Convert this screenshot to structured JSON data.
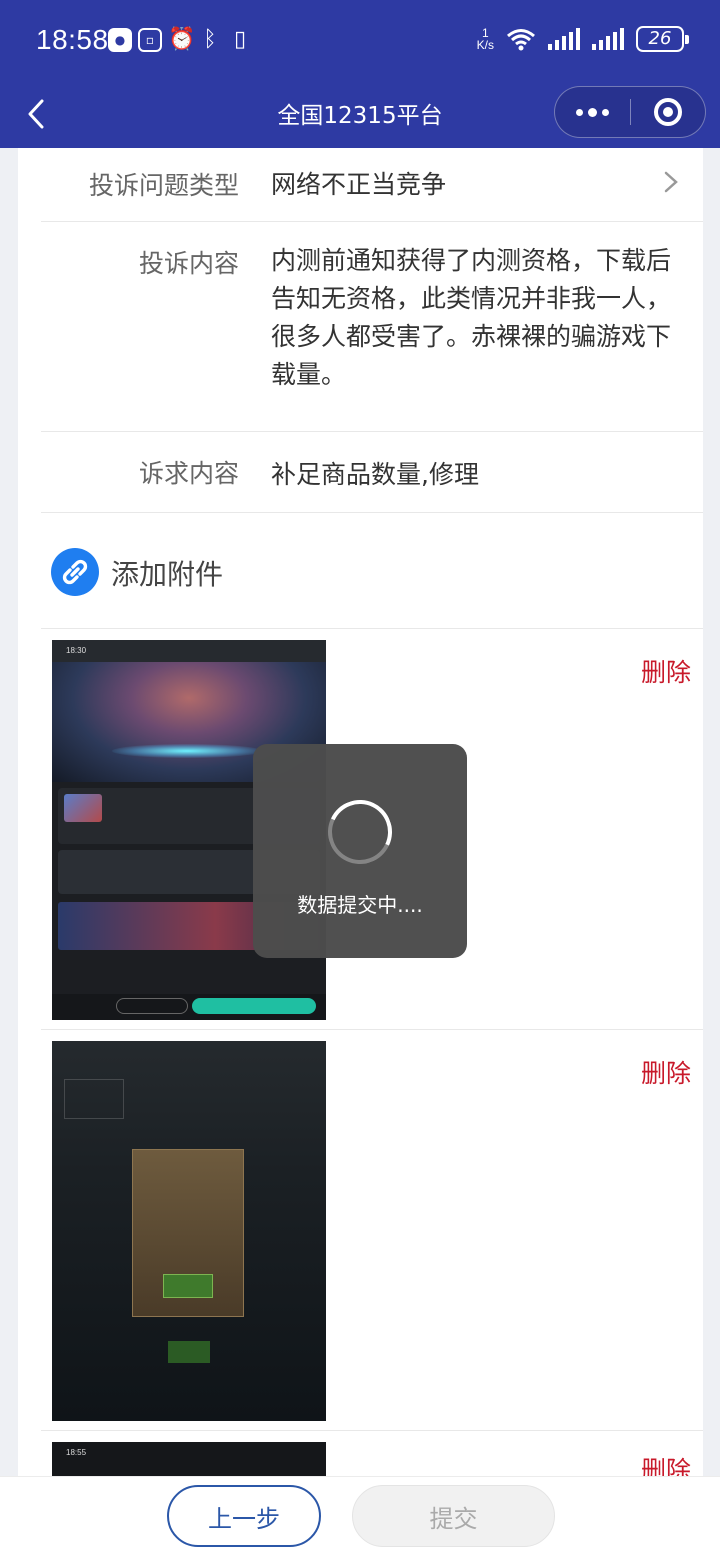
{
  "status_bar": {
    "time": "18:58",
    "net_speed_value": "1",
    "net_speed_unit": "K/s",
    "battery": "26",
    "left_icons": [
      "wechat-icon",
      "app-icon",
      "alarm-icon",
      "bluetooth-icon",
      "vibrate-icon"
    ]
  },
  "nav": {
    "title": "全国12315平台"
  },
  "form": {
    "complaint_type": {
      "label": "投诉问题类型",
      "value": "网络不正当竞争"
    },
    "complaint_content": {
      "label": "投诉内容",
      "value": "内测前通知获得了内测资格，下载后告知无资格，此类情况并非我一人，很多人都受害了。赤裸裸的骗游戏下载量。"
    },
    "request_content": {
      "label": "诉求内容",
      "value": "补足商品数量,修理"
    }
  },
  "attachments": {
    "add_label": "添加附件",
    "delete_label": "删除",
    "items": [
      {
        "thumb_time": "18:30"
      },
      {
        "thumb_time": ""
      },
      {
        "thumb_time": "18:55"
      }
    ]
  },
  "loading": {
    "text": "数据提交中...."
  },
  "footer": {
    "prev_label": "上一步",
    "submit_label": "提交"
  },
  "colors": {
    "header": "#2e3aa3",
    "delete": "#c8192a",
    "attach_icon": "#1f7ef0",
    "prev_border": "#2b57a8"
  }
}
